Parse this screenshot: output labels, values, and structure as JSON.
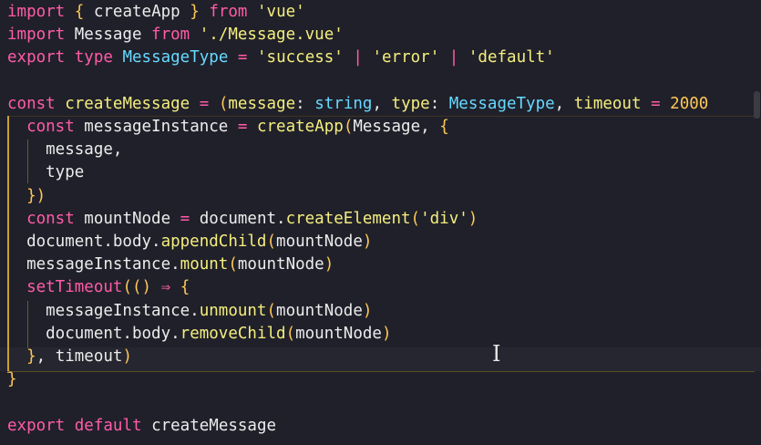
{
  "colors": {
    "background": "#20202a",
    "keyword": "#ff5ca8",
    "string": "#f4ee7e",
    "function": "#ff5ca8",
    "type": "#66d9ff",
    "punct": "#ffc857",
    "plain": "#ececec",
    "guide": "#c9a02f"
  },
  "code_lines": [
    [
      {
        "t": "import",
        "c": "keyword"
      },
      {
        "t": " ",
        "c": "plain"
      },
      {
        "t": "{",
        "c": "punct"
      },
      {
        "t": " createApp ",
        "c": "plain"
      },
      {
        "t": "}",
        "c": "punct"
      },
      {
        "t": " ",
        "c": "plain"
      },
      {
        "t": "from",
        "c": "keyword"
      },
      {
        "t": " ",
        "c": "plain"
      },
      {
        "t": "'vue'",
        "c": "string"
      }
    ],
    [
      {
        "t": "import",
        "c": "keyword"
      },
      {
        "t": " Message ",
        "c": "plain"
      },
      {
        "t": "from",
        "c": "keyword"
      },
      {
        "t": " ",
        "c": "plain"
      },
      {
        "t": "'./Message.vue'",
        "c": "string"
      }
    ],
    [
      {
        "t": "export",
        "c": "keyword"
      },
      {
        "t": " ",
        "c": "plain"
      },
      {
        "t": "type",
        "c": "keyword"
      },
      {
        "t": " ",
        "c": "plain"
      },
      {
        "t": "MessageType",
        "c": "type"
      },
      {
        "t": " ",
        "c": "plain"
      },
      {
        "t": "=",
        "c": "keyword"
      },
      {
        "t": " ",
        "c": "plain"
      },
      {
        "t": "'success'",
        "c": "string"
      },
      {
        "t": " ",
        "c": "plain"
      },
      {
        "t": "|",
        "c": "keyword"
      },
      {
        "t": " ",
        "c": "plain"
      },
      {
        "t": "'error'",
        "c": "string"
      },
      {
        "t": " ",
        "c": "plain"
      },
      {
        "t": "|",
        "c": "keyword"
      },
      {
        "t": " ",
        "c": "plain"
      },
      {
        "t": "'default'",
        "c": "string"
      }
    ],
    [],
    [
      {
        "t": "const",
        "c": "keyword"
      },
      {
        "t": " ",
        "c": "plain"
      },
      {
        "t": "createMessage",
        "c": "string"
      },
      {
        "t": " ",
        "c": "plain"
      },
      {
        "t": "=",
        "c": "keyword"
      },
      {
        "t": " ",
        "c": "plain"
      },
      {
        "t": "(",
        "c": "punct"
      },
      {
        "t": "message",
        "c": "string"
      },
      {
        "t": ": ",
        "c": "plain"
      },
      {
        "t": "string",
        "c": "type"
      },
      {
        "t": ", ",
        "c": "plain"
      },
      {
        "t": "type",
        "c": "string"
      },
      {
        "t": ": ",
        "c": "plain"
      },
      {
        "t": "MessageType",
        "c": "type"
      },
      {
        "t": ", ",
        "c": "plain"
      },
      {
        "t": "timeout",
        "c": "string"
      },
      {
        "t": " ",
        "c": "plain"
      },
      {
        "t": "=",
        "c": "keyword"
      },
      {
        "t": " ",
        "c": "plain"
      },
      {
        "t": "2000",
        "c": "punct"
      }
    ],
    [
      {
        "t": "  ",
        "c": "plain"
      },
      {
        "t": "const",
        "c": "keyword"
      },
      {
        "t": " messageInstance ",
        "c": "plain"
      },
      {
        "t": "=",
        "c": "keyword"
      },
      {
        "t": " ",
        "c": "plain"
      },
      {
        "t": "createApp",
        "c": "string"
      },
      {
        "t": "(",
        "c": "punct"
      },
      {
        "t": "Message, ",
        "c": "plain"
      },
      {
        "t": "{",
        "c": "punct"
      }
    ],
    [
      {
        "t": "    message,",
        "c": "plain"
      }
    ],
    [
      {
        "t": "    type",
        "c": "plain"
      }
    ],
    [
      {
        "t": "  ",
        "c": "plain"
      },
      {
        "t": "})",
        "c": "punct"
      }
    ],
    [
      {
        "t": "  ",
        "c": "plain"
      },
      {
        "t": "const",
        "c": "keyword"
      },
      {
        "t": " mountNode ",
        "c": "plain"
      },
      {
        "t": "=",
        "c": "keyword"
      },
      {
        "t": " document.",
        "c": "plain"
      },
      {
        "t": "createElement",
        "c": "string"
      },
      {
        "t": "(",
        "c": "punct"
      },
      {
        "t": "'div'",
        "c": "string"
      },
      {
        "t": ")",
        "c": "punct"
      }
    ],
    [
      {
        "t": "  document.body.",
        "c": "plain"
      },
      {
        "t": "appendChild",
        "c": "string"
      },
      {
        "t": "(",
        "c": "punct"
      },
      {
        "t": "mountNode",
        "c": "plain"
      },
      {
        "t": ")",
        "c": "punct"
      }
    ],
    [
      {
        "t": "  messageInstance.",
        "c": "plain"
      },
      {
        "t": "mount",
        "c": "string"
      },
      {
        "t": "(",
        "c": "punct"
      },
      {
        "t": "mountNode",
        "c": "plain"
      },
      {
        "t": ")",
        "c": "punct"
      }
    ],
    [
      {
        "t": "  ",
        "c": "plain"
      },
      {
        "t": "setTimeout",
        "c": "keyword"
      },
      {
        "t": "((",
        "c": "punct"
      },
      {
        "t": ")",
        "c": "punct"
      },
      {
        "t": " ",
        "c": "plain"
      },
      {
        "t": "⇒",
        "c": "keyword"
      },
      {
        "t": " ",
        "c": "plain"
      },
      {
        "t": "{",
        "c": "punct"
      }
    ],
    [
      {
        "t": "    messageInstance.",
        "c": "plain"
      },
      {
        "t": "unmount",
        "c": "string"
      },
      {
        "t": "(",
        "c": "punct"
      },
      {
        "t": "mountNode",
        "c": "plain"
      },
      {
        "t": ")",
        "c": "punct"
      }
    ],
    [
      {
        "t": "    document.body.",
        "c": "plain"
      },
      {
        "t": "removeChild",
        "c": "string"
      },
      {
        "t": "(",
        "c": "punct"
      },
      {
        "t": "mountNode",
        "c": "plain"
      },
      {
        "t": ")",
        "c": "punct"
      }
    ],
    [
      {
        "t": "  ",
        "c": "plain"
      },
      {
        "t": "}",
        "c": "punct"
      },
      {
        "t": ", timeout",
        "c": "plain"
      },
      {
        "t": ")",
        "c": "punct"
      }
    ],
    [
      {
        "t": "}",
        "c": "punct"
      }
    ],
    [],
    [
      {
        "t": "export",
        "c": "keyword"
      },
      {
        "t": " ",
        "c": "plain"
      },
      {
        "t": "default",
        "c": "keyword"
      },
      {
        "t": " createMessage",
        "c": "plain"
      }
    ]
  ]
}
